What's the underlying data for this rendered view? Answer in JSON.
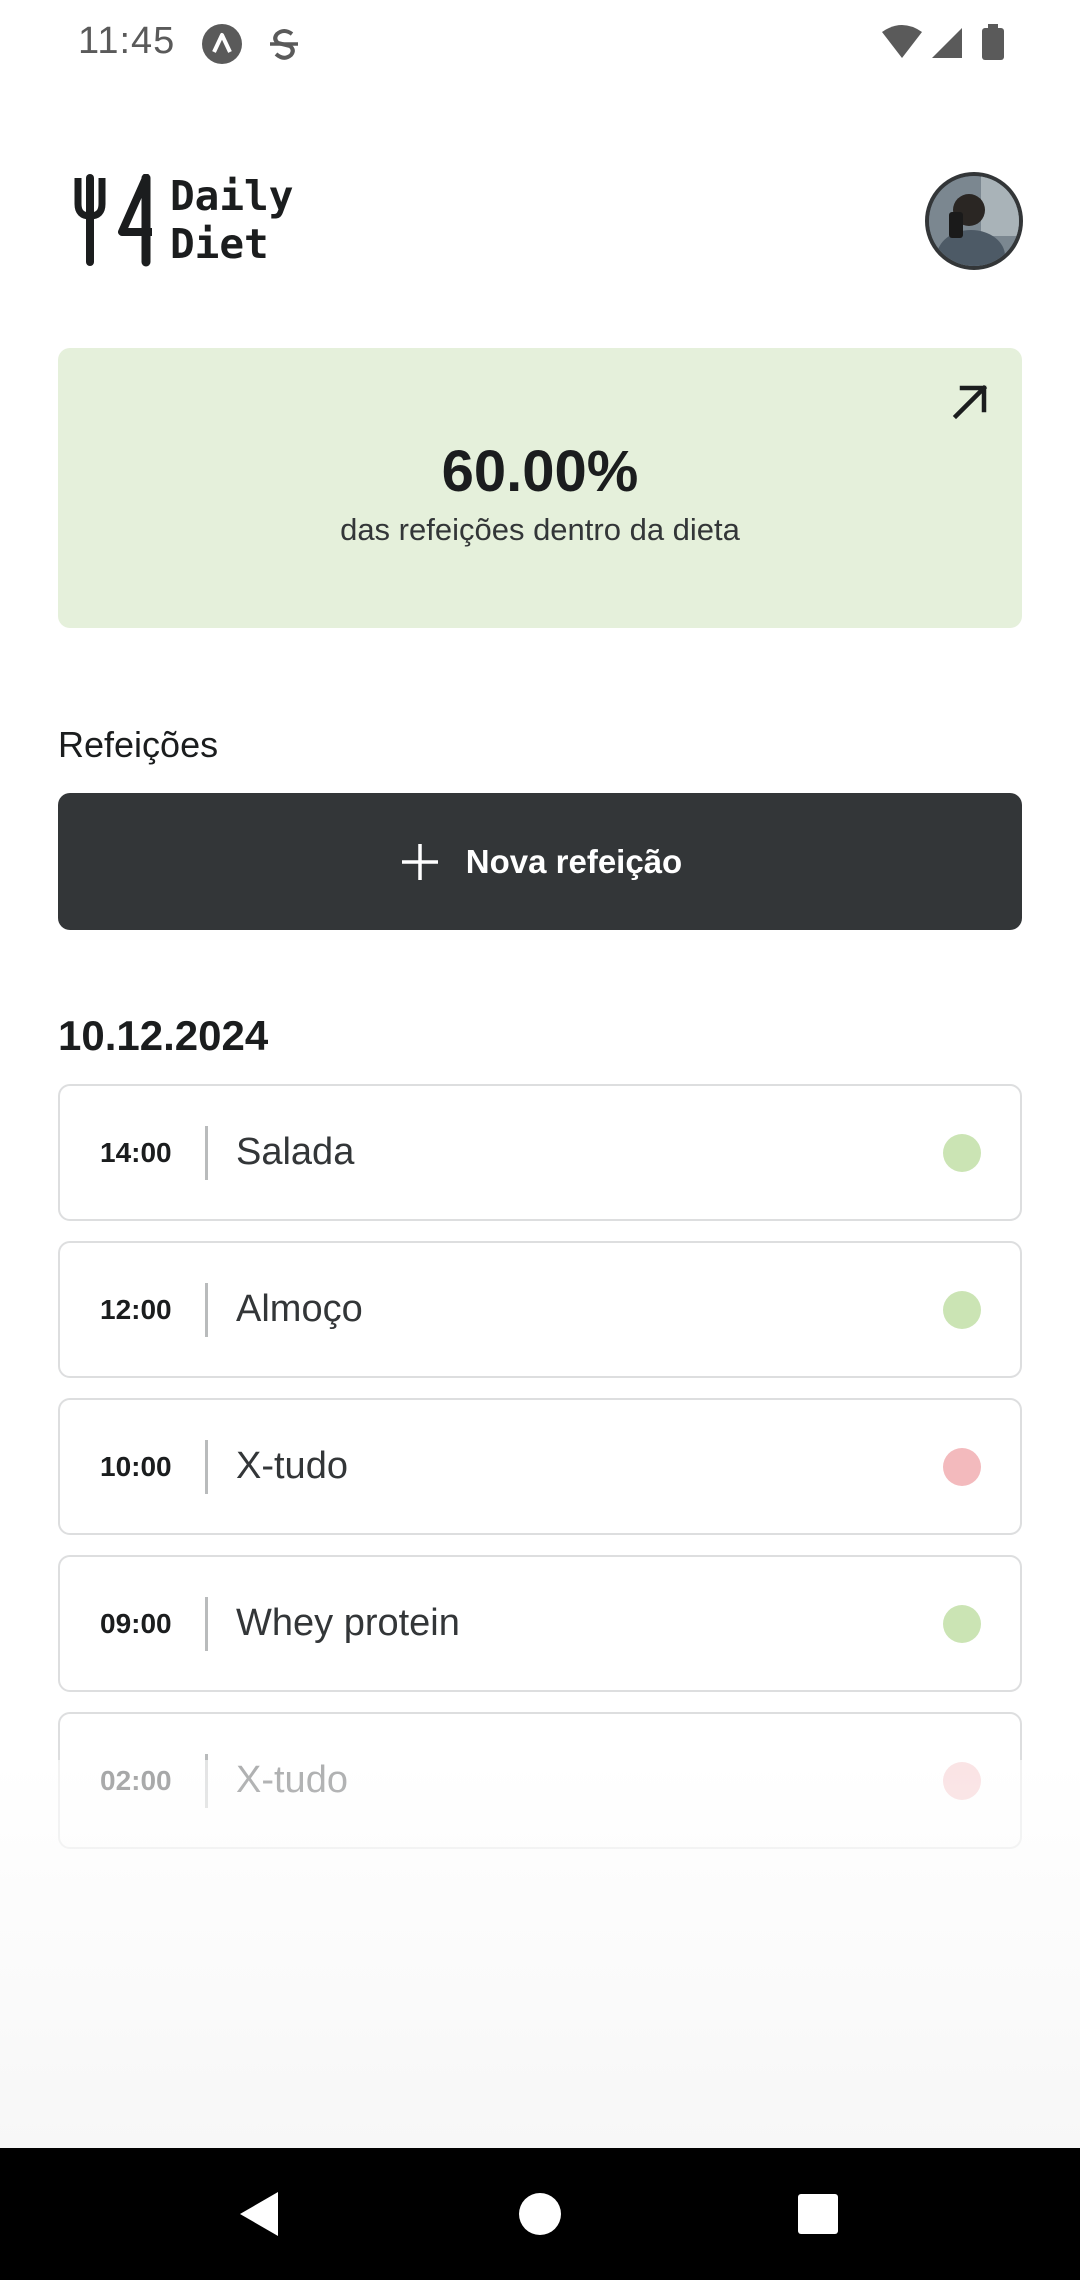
{
  "status_bar": {
    "time": "11:45"
  },
  "header": {
    "logo_line1": "Daily",
    "logo_line2": "Diet"
  },
  "stats": {
    "percent": "60.00%",
    "description": "das refeições dentro da dieta",
    "color": "#e5f0db"
  },
  "meals": {
    "title": "Refeições",
    "new_button_label": "Nova refeição",
    "date": "10.12.2024",
    "items": [
      {
        "time": "14:00",
        "name": "Salada",
        "in_diet": true
      },
      {
        "time": "12:00",
        "name": "Almoço",
        "in_diet": true
      },
      {
        "time": "10:00",
        "name": "X-tudo",
        "in_diet": false
      },
      {
        "time": "09:00",
        "name": "Whey protein",
        "in_diet": true
      },
      {
        "time": "02:00",
        "name": "X-tudo",
        "in_diet": false
      }
    ]
  },
  "colors": {
    "in_diet": "#cbe4b4",
    "off_diet": "#f3babd",
    "dark": "#333638"
  }
}
